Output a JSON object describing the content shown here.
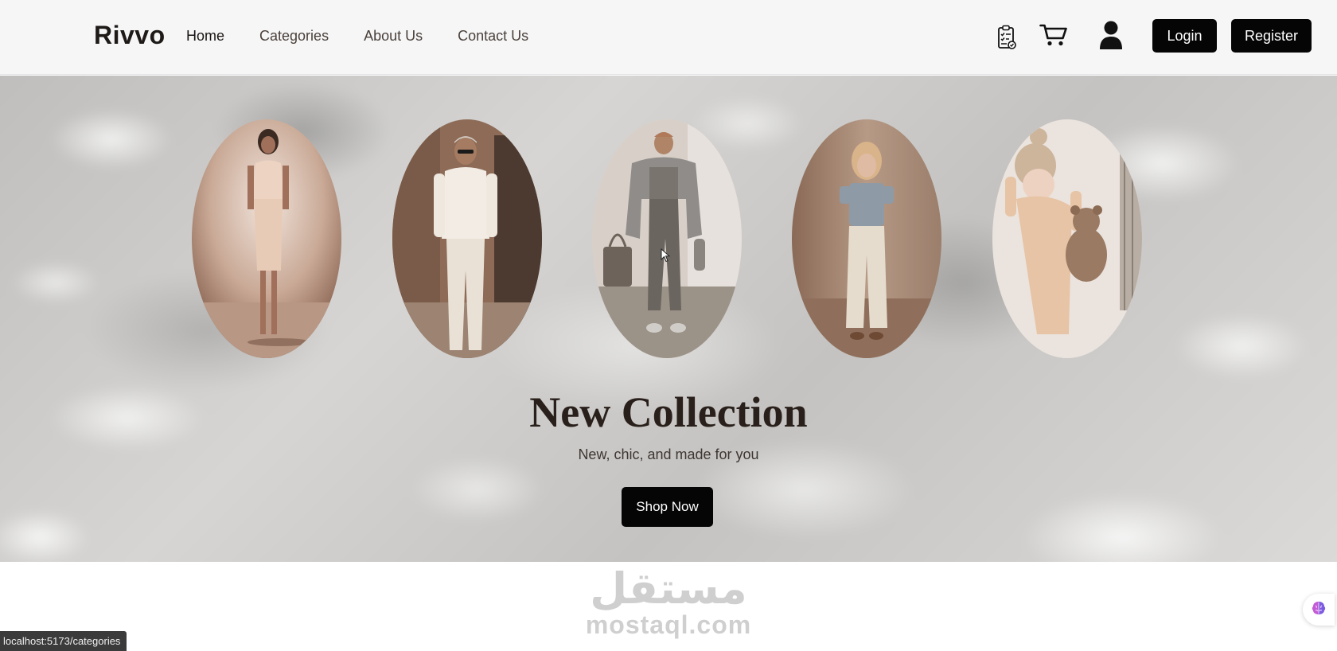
{
  "navbar": {
    "brand": "Rivvo",
    "links": [
      {
        "label": "Home",
        "active": true
      },
      {
        "label": "Categories",
        "active": false
      },
      {
        "label": "About Us",
        "active": false
      },
      {
        "label": "Contact Us",
        "active": false
      }
    ],
    "icons": [
      "clipboard-checklist-icon",
      "cart-icon",
      "user-icon"
    ],
    "login_label": "Login",
    "register_label": "Register"
  },
  "hero": {
    "title": "New Collection",
    "subtitle": "New, chic, and made for you",
    "cta_label": "Shop Now",
    "collection_images": [
      "woman-fashion-photo",
      "man-fashion-photo",
      "sportswear-fashion-photo",
      "girl-fashion-photo",
      "baby-fashion-photo"
    ]
  },
  "watermark": {
    "arabic": "مستقل",
    "latin": "mostaql.com"
  },
  "status_bar": {
    "url": "localhost:5173/categories"
  },
  "floating_widget": {
    "icon": "brain-icon"
  },
  "colors": {
    "primary_button": "#050505",
    "navbar_bg": "#f6f6f7",
    "title_text": "#2a201b"
  }
}
